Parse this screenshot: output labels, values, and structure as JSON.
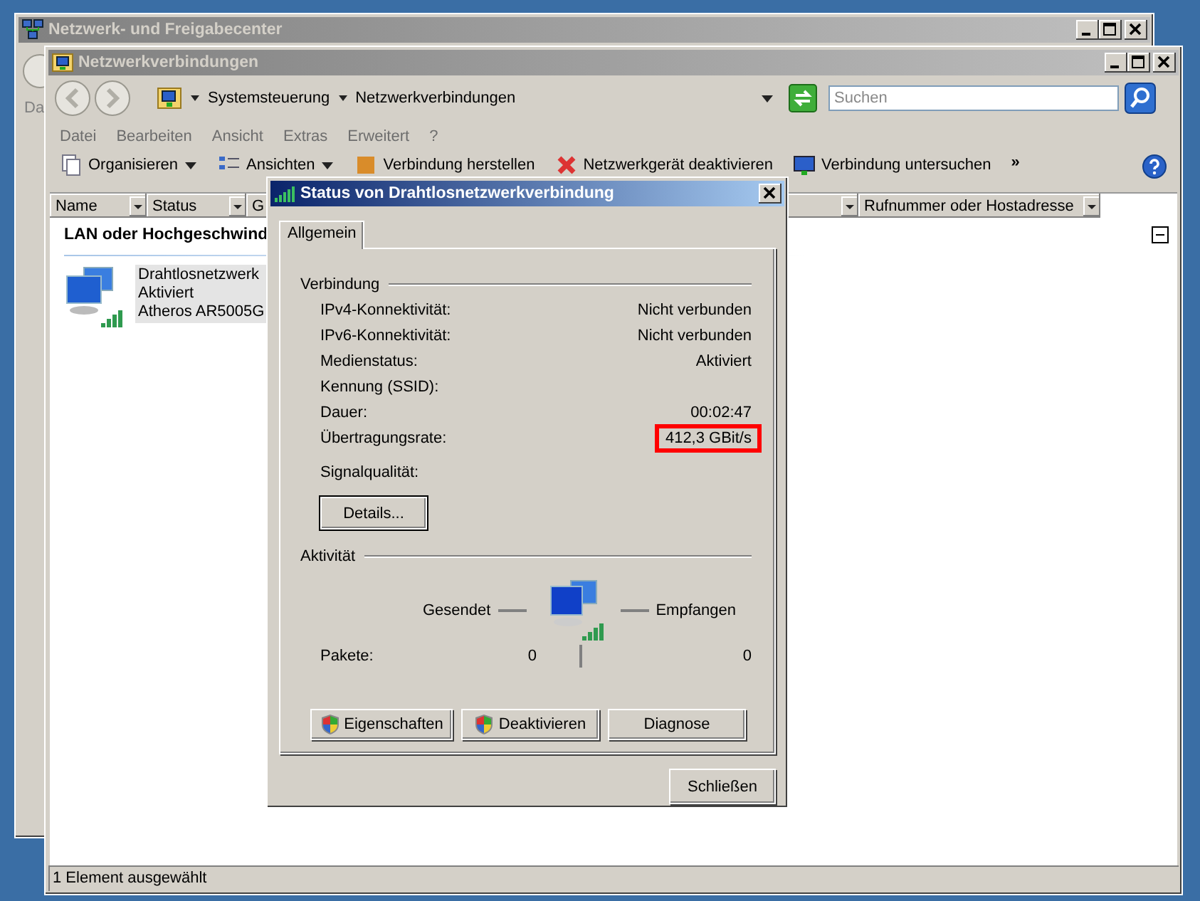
{
  "background_window": {
    "title": "Netzwerk- und Freigabecenter",
    "active": false,
    "peek_text": "Da"
  },
  "window": {
    "title": "Netzwerkverbindungen",
    "active": false,
    "address": [
      "Systemsteuerung",
      "Netzwerkverbindungen"
    ],
    "search": {
      "placeholder": "Suchen"
    },
    "menu": [
      "Datei",
      "Bearbeiten",
      "Ansicht",
      "Extras",
      "Erweitert",
      "?"
    ],
    "toolbar": [
      {
        "label": "Organisieren",
        "kind": "organize"
      },
      {
        "label": "Ansichten",
        "kind": "views"
      },
      {
        "label": "Verbindung herstellen",
        "kind": "connect"
      },
      {
        "label": "Netzwerkgerät deaktivieren",
        "kind": "disable"
      },
      {
        "label": "Verbindung untersuchen",
        "kind": "diagnose"
      },
      {
        "label": "»",
        "kind": "more"
      }
    ],
    "columns": [
      "Name",
      "Status",
      "G",
      "Rufnummer oder Hostadresse"
    ],
    "group": {
      "label": "LAN oder Hochgeschwind",
      "expanded": true
    },
    "items": [
      {
        "lines": [
          "Drahtlosnetzwerk",
          "Aktiviert",
          "Atheros AR5005G"
        ],
        "selected": true
      }
    ],
    "status_bar": "1 Element ausgewählt"
  },
  "dialog": {
    "title": "Status von Drahtlosnetzwerkverbindung",
    "active": true,
    "tabs": [
      {
        "label": "Allgemein",
        "selected": true
      }
    ],
    "connection_heading": "Verbindung",
    "rows": [
      {
        "label": "IPv4-Konnektivität:",
        "value": "Nicht verbunden",
        "highlighted": false
      },
      {
        "label": "IPv6-Konnektivität:",
        "value": "Nicht verbunden",
        "highlighted": false
      },
      {
        "label": "Medienstatus:",
        "value": "Aktiviert",
        "highlighted": false
      },
      {
        "label": "Kennung (SSID):",
        "highlighted": false
      },
      {
        "label": "Dauer:",
        "value": "00:02:47",
        "highlighted": false
      },
      {
        "label": "Übertragungsrate:",
        "value": "412,3 GBit/s",
        "highlighted": true
      }
    ],
    "signal_label": "Signalqualität:",
    "details_button": {
      "label": "Details...",
      "focused": true
    },
    "activity_heading": "Aktivität",
    "sent_label": "Gesendet",
    "received_label": "Empfangen",
    "packets_label": "Pakete:",
    "packets_sent": "0",
    "packets_received": "0",
    "buttons": [
      {
        "label": "Eigenschaften",
        "shield": true
      },
      {
        "label": "Deaktivieren",
        "shield": true
      },
      {
        "label": "Diagnose",
        "shield": false
      }
    ],
    "close_button": "Schließen"
  }
}
